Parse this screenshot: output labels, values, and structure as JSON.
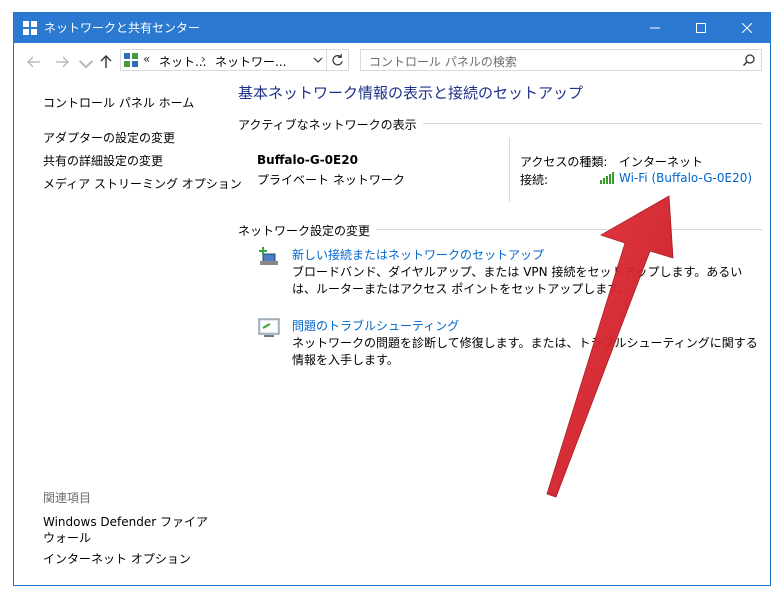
{
  "window": {
    "title": "ネットワークと共有センター",
    "accent": "#2b79d0"
  },
  "toolbar": {
    "address_prefix": "«",
    "breadcrumb": [
      "ネット...",
      "ネットワー..."
    ],
    "breadcrumb_sep": "›",
    "search_placeholder": "コントロール パネルの検索"
  },
  "sidebar": {
    "home": "コントロール パネル ホーム",
    "items": [
      "アダプターの設定の変更",
      "共有の詳細設定の変更",
      "メディア ストリーミング オプション"
    ],
    "related_heading": "関連項目",
    "related": [
      "Windows Defender ファイアウォール",
      "インターネット オプション"
    ]
  },
  "main": {
    "title": "基本ネットワーク情報の表示と接続のセットアップ",
    "active_heading": "アクティブなネットワークの表示",
    "network_name": "Buffalo-G-0E20",
    "network_type": "プライベート ネットワーク",
    "access_label": "アクセスの種類:",
    "access_value": "インターネット",
    "connection_label": "接続:",
    "connection_value": "Wi-Fi (Buffalo-G-0E20)",
    "change_heading": "ネットワーク設定の変更",
    "tasks": [
      {
        "icon": "new-connection-icon",
        "link": "新しい接続またはネットワークのセットアップ",
        "desc": "ブロードバンド、ダイヤルアップ、または VPN 接続をセットアップします。あるいは、ルーターまたはアクセス ポイントをセットアップします。"
      },
      {
        "icon": "troubleshoot-icon",
        "link": "問題のトラブルシューティング",
        "desc": "ネットワークの問題を診断して修復します。または、トラブルシューティングに関する情報を入手します。"
      }
    ]
  },
  "colors": {
    "link": "#0066cc",
    "title": "#1e3287",
    "annotation_arrow": "#d9232e"
  }
}
